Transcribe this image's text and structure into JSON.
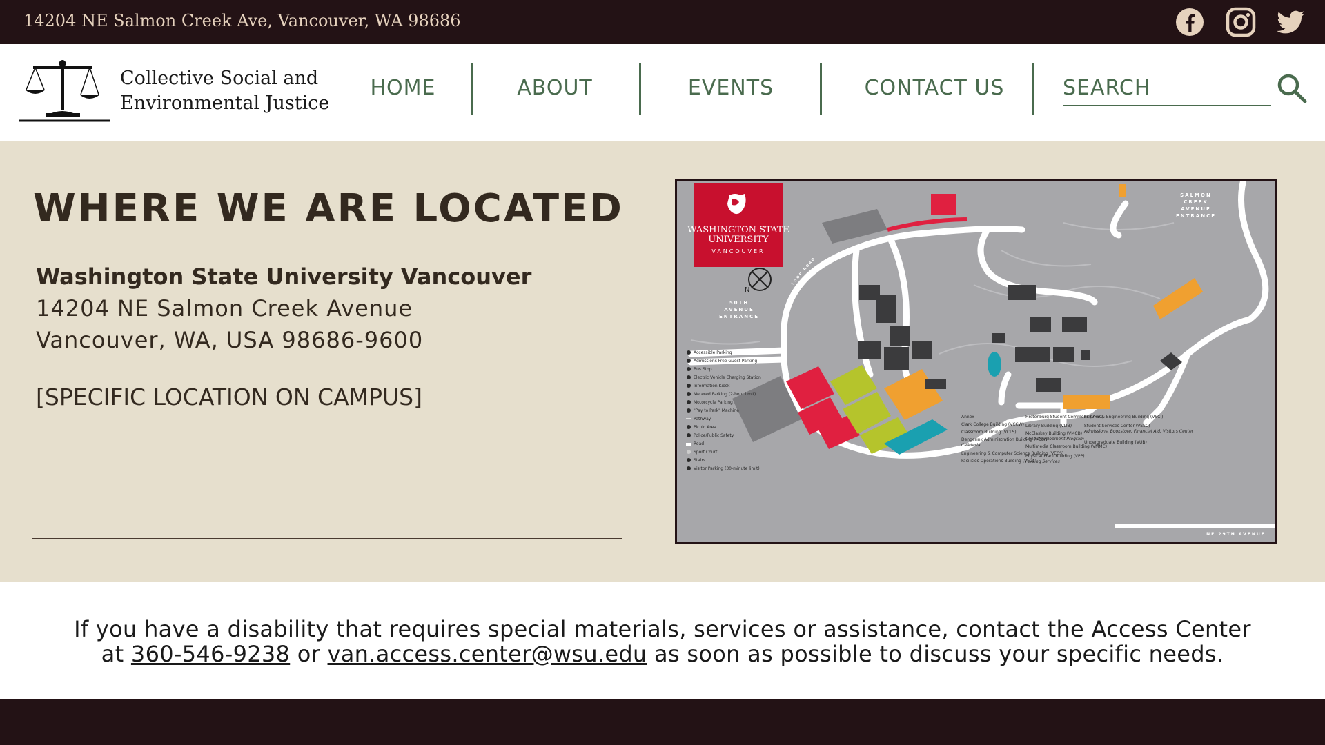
{
  "topbar": {
    "address": "14204 NE Salmon Creek Ave, Vancouver, WA 98686",
    "social": [
      "facebook-icon",
      "instagram-icon",
      "twitter-icon"
    ],
    "background": "#231215",
    "text_color": "#e6d2bd"
  },
  "header": {
    "org_line1": "Collective Social and",
    "org_line2": "Environmental Justice",
    "nav": [
      {
        "label": "HOME"
      },
      {
        "label": "ABOUT"
      },
      {
        "label": "EVENTS"
      },
      {
        "label": "CONTACT US"
      }
    ],
    "search_placeholder": "SEARCH",
    "accent": "#4a6b4e"
  },
  "location": {
    "title": "WHERE WE ARE LOCATED",
    "name": "Washington State University Vancouver",
    "street": "14204 NE Salmon Creek Avenue",
    "city": "Vancouver, WA, USA 98686-9600",
    "specific": "[SPECIFIC LOCATION ON CAMPUS]",
    "background": "#e6dfcd"
  },
  "map": {
    "brand_line1": "WASHINGTON STATE",
    "brand_line2": "UNIVERSITY",
    "brand_line3": "VANCOUVER",
    "label_salmon_1": "SALMON",
    "label_salmon_2": "CREEK",
    "label_salmon_3": "AVENUE",
    "label_salmon_4": "ENTRANCE",
    "label_50th_1": "50TH",
    "label_50th_2": "AVENUE",
    "label_50th_3": "ENTRANCE",
    "label_29th": "NE 29TH AVENUE",
    "label_loop": "LOOP ROAD",
    "compass_n": "N",
    "legend": [
      "Accessible Parking",
      "Admissions Free Guest Parking",
      "Bus Stop",
      "Electric Vehicle Charging Station",
      "Information Kiosk",
      "Metered Parking (2-hour limit)",
      "Motorcycle Parking",
      "\"Pay to Park\" Machine",
      "Pathway",
      "Picnic Area",
      "Police/Public Safety",
      "Road",
      "Sport Court",
      "Stairs",
      "Visitor Parking (30-minute limit)"
    ],
    "buildings_col1": [
      "Annex",
      "Clark College Building (VCCW)",
      "Classroom Building (VCLS)",
      "Dengerink Administration Building (VDEN)",
      "Cafeteria",
      "Engineering & Computer Science Building (VECS)",
      "Facilities Operations Building (VFO)"
    ],
    "buildings_col2": [
      "Firstenburg Student Commons (VFSC)",
      "Library Building (VLIB)",
      "McClaskey Building (VMCB)",
      "Child Development Program",
      "Multimedia Classroom Building (VMMC)",
      "Physical Plant Building (VPP)",
      "Parking Services"
    ],
    "buildings_col3": [
      "Science & Engineering Building (VSCI)",
      "Student Services Center (VSSC)",
      "Admissions, Bookstore, Financial Aid, Visitors Center",
      "Undergraduate Building (VUB)"
    ],
    "colors": {
      "background": "#a7a7aa",
      "road": "#ffffff",
      "crimson": "#c8102e",
      "red_lot": "#e02040",
      "yellow_lot": "#b5c42c",
      "orange_lot": "#f0a030",
      "teal_lot": "#1aa0b0",
      "building": "#3b3b3d"
    }
  },
  "notice": {
    "text_before": "If you have a disability that requires special materials, services or assistance, contact the Access Center",
    "text_at": "at",
    "phone": "360-546-9238",
    "text_or": "or",
    "email": "van.access.center@wsu.edu",
    "text_after": "as soon as possible to discuss your specific needs."
  },
  "footer": {
    "background": "#231215"
  }
}
